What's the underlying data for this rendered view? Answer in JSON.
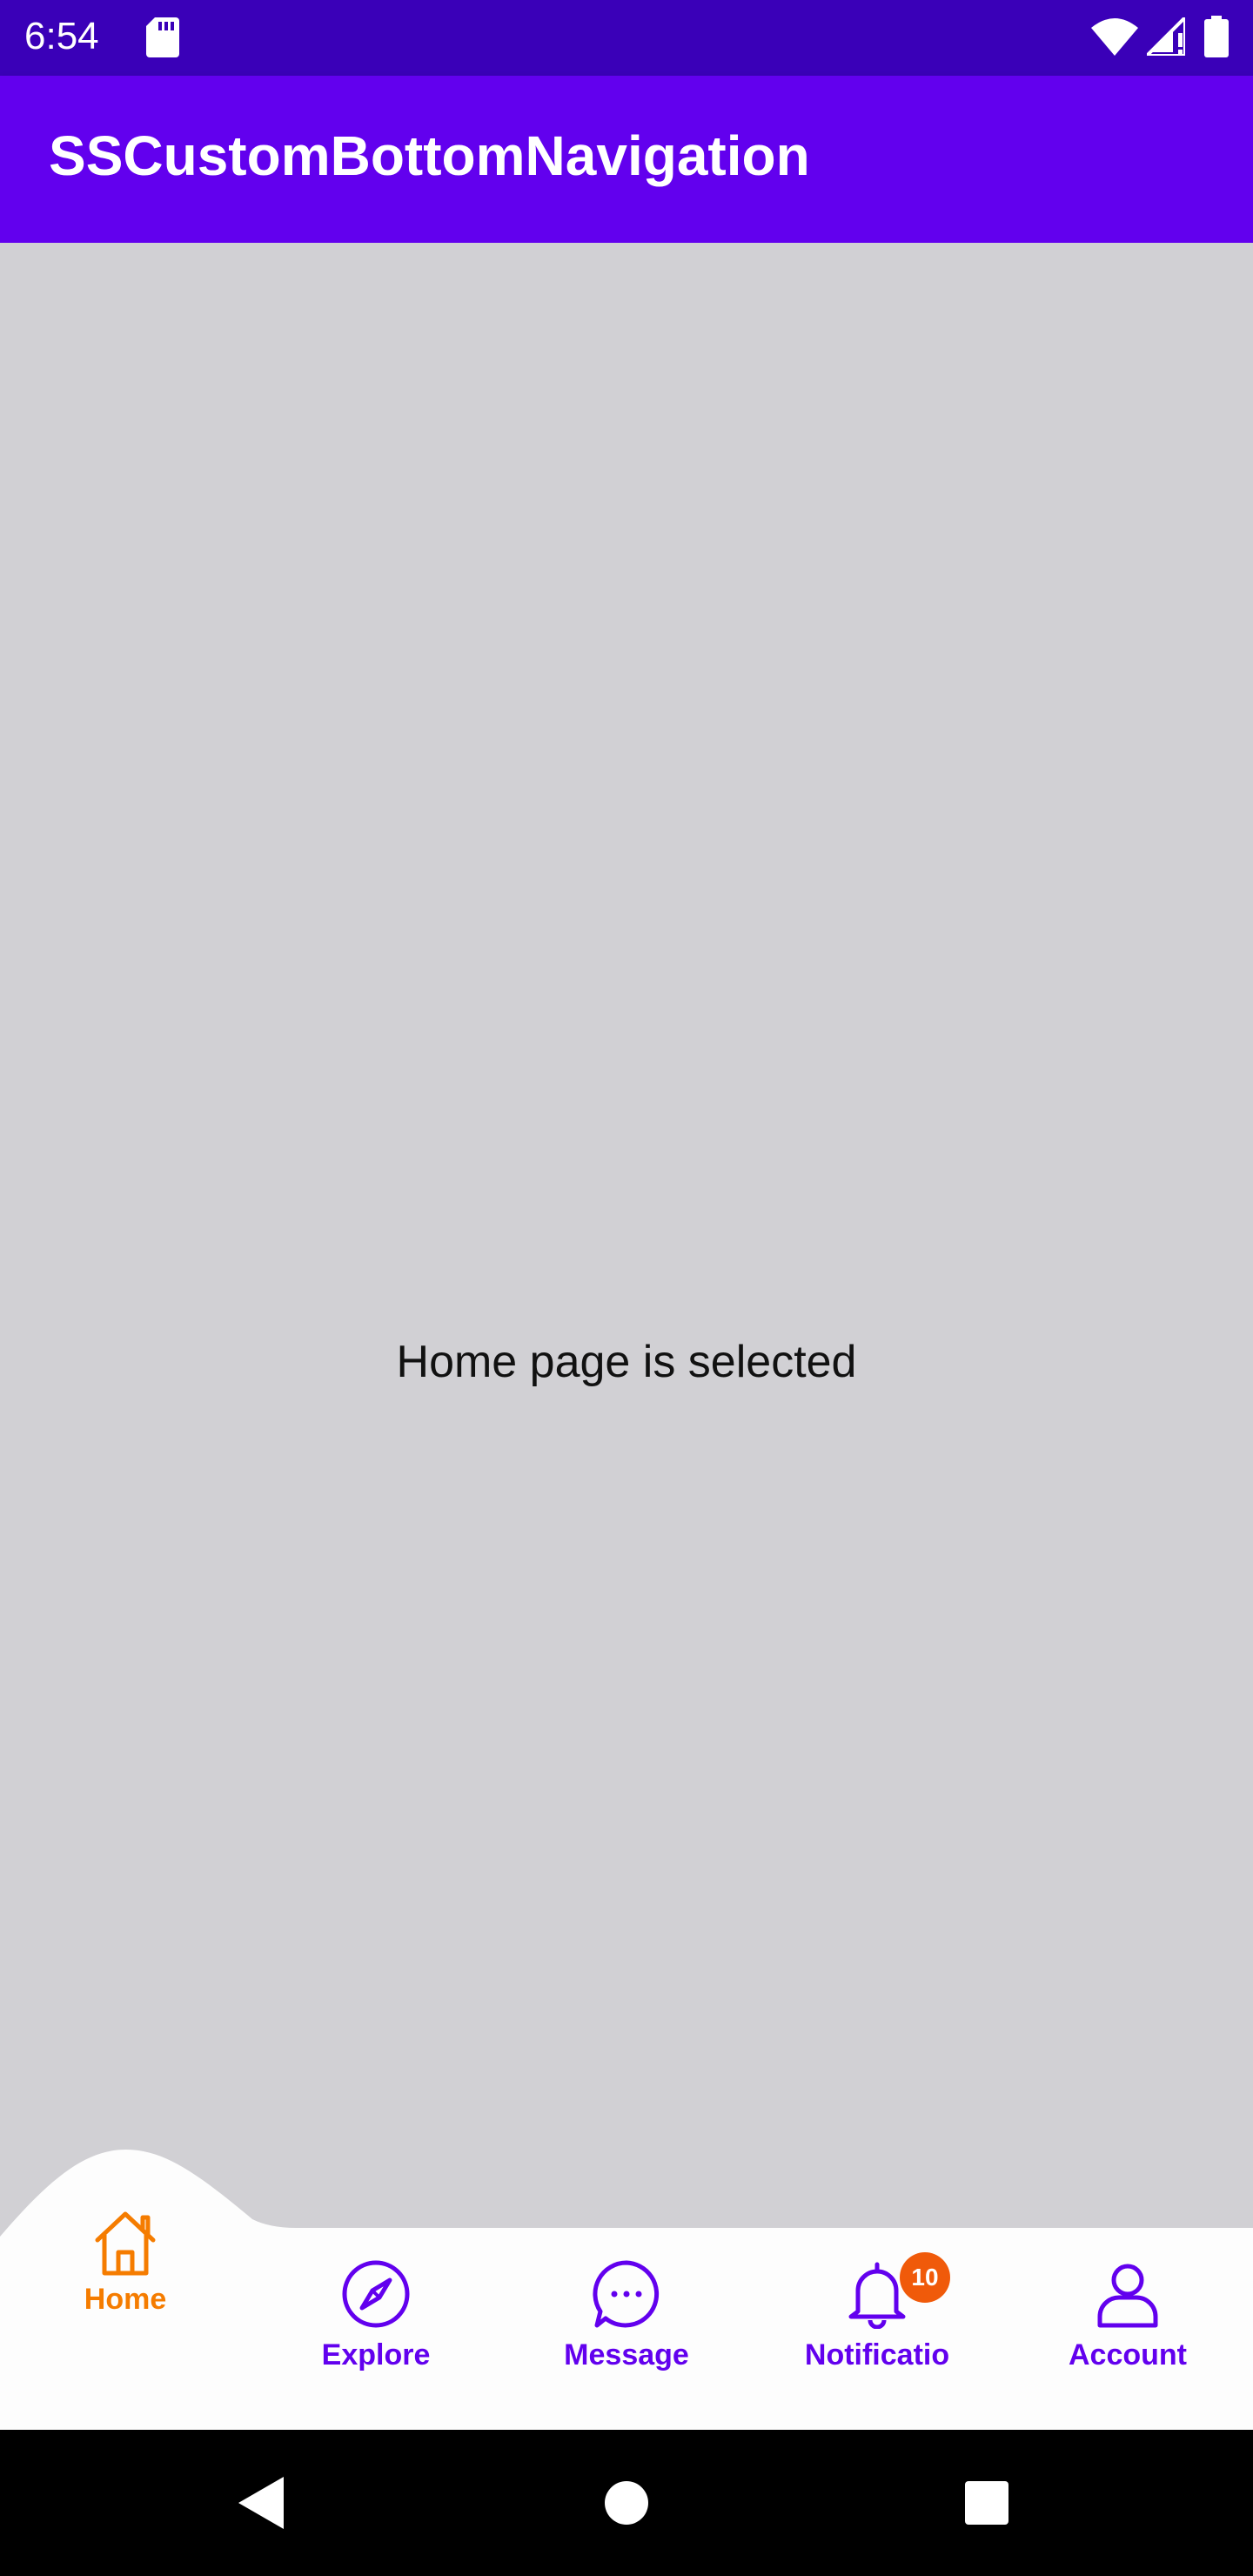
{
  "status_bar": {
    "time": "6:54",
    "icons": [
      "sd-card-icon",
      "wifi-icon",
      "signal-icon",
      "battery-icon"
    ]
  },
  "app_bar": {
    "title": "SSCustomBottomNavigation"
  },
  "content": {
    "text": "Home page is selected"
  },
  "bottom_nav": {
    "items": [
      {
        "label": "Home",
        "icon": "home-icon",
        "selected": true
      },
      {
        "label": "Explore",
        "icon": "compass-icon",
        "selected": false
      },
      {
        "label": "Message",
        "icon": "chat-bubble-icon",
        "selected": false
      },
      {
        "label": "Notificatio",
        "icon": "bell-icon",
        "selected": false,
        "badge": "10"
      },
      {
        "label": "Account",
        "icon": "person-icon",
        "selected": false
      }
    ]
  },
  "colors": {
    "status_bar": "#3a00b8",
    "app_bar": "#6200ee",
    "selected_accent": "#f57c00",
    "unselected": "#6200ee",
    "badge": "#f05a0a",
    "background": "#d1d0d4"
  },
  "system_nav": {
    "buttons": [
      "back-icon",
      "home-circle-icon",
      "recents-icon"
    ]
  }
}
